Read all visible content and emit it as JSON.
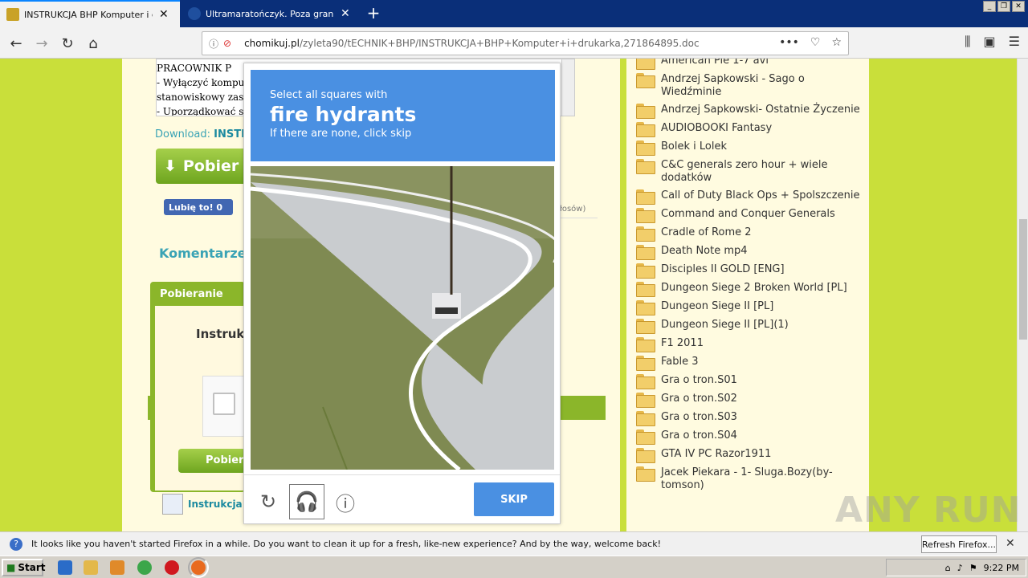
{
  "tabs": [
    {
      "title": "INSTRUKCJA BHP Komputer i druka",
      "active": true
    },
    {
      "title": "Ultramaratończyk. Poza granicami",
      "active": false
    }
  ],
  "url": {
    "domain": "chomikuj.pl",
    "path": "/zyleta90/tECHNIK+BHP/INSTRUKCJA+BHP+Komputer+i+drukarka,271864895.doc"
  },
  "page": {
    "doc_lines": [
      "PRACOWNIK P",
      "- Wyłączyć kompu",
      "stanowiskowy zas",
      "- Uporządkować s"
    ],
    "download_label": "Download:",
    "download_link": "INSTRU",
    "pobierz_label": "Pobier",
    "like_label": "Lubię to! 0",
    "glosow": "łosów)",
    "komentarze": "Komentarze:",
    "pobieranie_header": "Pobieranie",
    "instrukc_title": "Instruk",
    "pobierz2_label": "Pobier",
    "instruk2_label": "Instrukcja l"
  },
  "folders": [
    "American Pie 1-7 avi",
    "Andrzej Sapkowski - Sago o Wiedźminie",
    "Andrzej Sapkowski- Ostatnie Życzenie",
    "AUDIOBOOKI Fantasy",
    "Bolek i Lolek",
    "C&C generals zero hour + wiele dodatków",
    "Call of Duty Black Ops + Spolszczenie",
    "Command and Conquer Generals",
    "Cradle of Rome 2",
    "Death Note mp4",
    "Disciples II GOLD [ENG]",
    "Dungeon Siege 2 Broken World [PL]",
    "Dungeon Siege II [PL]",
    "Dungeon Siege II [PL](1)",
    "F1 2011",
    "Fable 3",
    "Gra o tron.S01",
    "Gra o tron.S02",
    "Gra o tron.S03",
    "Gra o tron.S04",
    "GTA IV PC Razor1911",
    "Jacek Piekara - 1- Sluga.Bozy(by-tomson)"
  ],
  "captcha": {
    "line1": "Select all squares with",
    "line2": "fire hydrants",
    "line3": "If there are none, click skip",
    "skip": "SKIP"
  },
  "notification": {
    "text": "It looks like you haven't started Firefox in a while. Do you want to clean it up for a fresh, like-new experience? And by the way, welcome back!",
    "button": "Refresh Firefox..."
  },
  "taskbar": {
    "start": "Start",
    "clock": "9:22 PM"
  },
  "watermark": "ANY RUN",
  "colors": {
    "tabbar": "#0a2f79",
    "page_bg": "#c9df3a",
    "captcha_blue": "#4a90e2",
    "panel_green": "#8bb62a"
  }
}
